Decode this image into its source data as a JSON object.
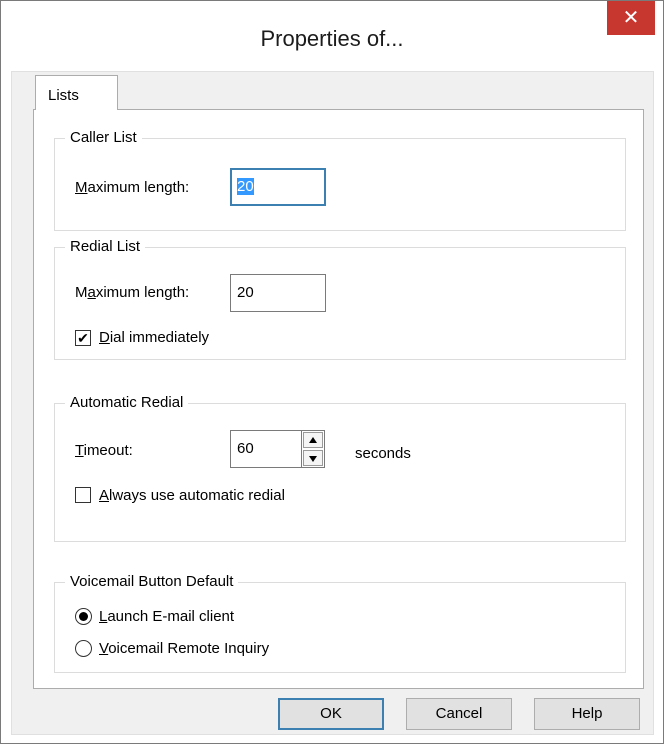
{
  "window": {
    "title": "Properties of...",
    "close_glyph": "✕",
    "close_icon": "close-icon"
  },
  "tabs": [
    {
      "label": "Lists",
      "selected": true
    }
  ],
  "caller_list": {
    "legend": "Caller List",
    "max_length_label": {
      "access_key": "M",
      "rest": "aximum length:"
    },
    "max_length_value": "20",
    "value_selected": true
  },
  "redial_list": {
    "legend": "Redial List",
    "max_length_label": {
      "before": "M",
      "access_key": "a",
      "rest": "ximum length:"
    },
    "max_length_value": "20",
    "dial_immediately": {
      "access_key": "D",
      "rest": "ial immediately",
      "checked": true,
      "check_glyph": "✔"
    }
  },
  "automatic_redial": {
    "legend": "Automatic Redial",
    "timeout_label": {
      "access_key": "T",
      "rest": "imeout:"
    },
    "timeout_value": "60",
    "timeout_unit": "seconds",
    "always_use": {
      "access_key": "A",
      "rest": "lways use automatic redial",
      "checked": false
    }
  },
  "voicemail_default": {
    "legend": "Voicemail Button Default",
    "options": [
      {
        "access_key": "L",
        "rest": "aunch E-mail client",
        "selected": true
      },
      {
        "access_key": "V",
        "rest": "oicemail Remote Inquiry",
        "selected": false
      }
    ]
  },
  "buttons": {
    "ok": "OK",
    "cancel": "Cancel",
    "help": "Help"
  }
}
